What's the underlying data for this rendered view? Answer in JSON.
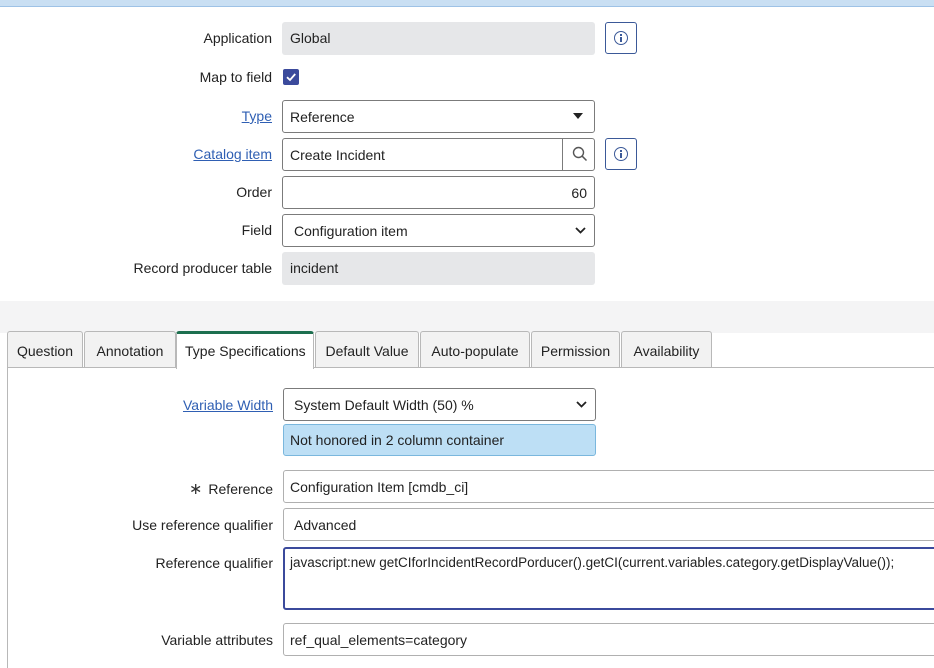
{
  "form": {
    "application": {
      "label": "Application",
      "value": "Global"
    },
    "map_to_field": {
      "label": "Map to field",
      "checked": true
    },
    "type": {
      "label": "Type",
      "value": "Reference"
    },
    "catalog_item": {
      "label": "Catalog item",
      "value": "Create Incident"
    },
    "order": {
      "label": "Order",
      "value": "60"
    },
    "field": {
      "label": "Field",
      "value": "Configuration item"
    },
    "record_producer_table": {
      "label": "Record producer table",
      "value": "incident"
    }
  },
  "tabs": [
    {
      "label": "Question",
      "active": false
    },
    {
      "label": "Annotation",
      "active": false
    },
    {
      "label": "Type Specifications",
      "active": true
    },
    {
      "label": "Default Value",
      "active": false
    },
    {
      "label": "Auto-populate",
      "active": false
    },
    {
      "label": "Permission",
      "active": false
    },
    {
      "label": "Availability",
      "active": false
    }
  ],
  "type_specs": {
    "variable_width": {
      "label": "Variable Width",
      "value": "System Default Width (50) %"
    },
    "width_note": "Not honored in 2 column container",
    "reference": {
      "label": "Reference",
      "value": "Configuration Item [cmdb_ci]",
      "mandatory_marker": "∗"
    },
    "use_reference_qualifier": {
      "label": "Use reference qualifier",
      "value": "Advanced"
    },
    "reference_qualifier": {
      "label": "Reference qualifier",
      "value": "javascript:new getCIforIncidentRecordPorducer().getCI(current.variables.category.getDisplayValue());"
    },
    "variable_attributes": {
      "label": "Variable attributes",
      "value": "ref_qual_elements=category"
    }
  },
  "colors": {
    "link": "#2f5fb3",
    "checkbox": "#3b4a9c",
    "active_tab_accent": "#1d6f4f",
    "note_bg": "#bddff5"
  }
}
